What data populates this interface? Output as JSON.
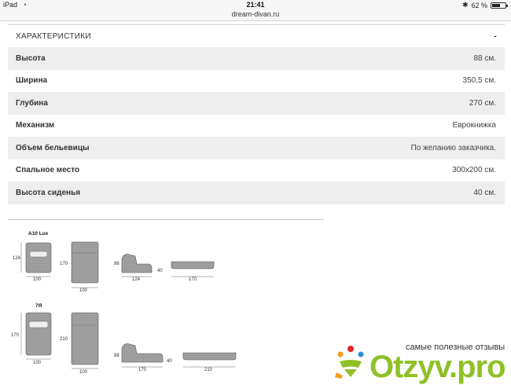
{
  "status_bar": {
    "device": "iPad",
    "time": "21:41",
    "url": "dream-divan.ru",
    "bluetooth": "✱",
    "battery_text": "62 %",
    "battery_level": 0.62
  },
  "characteristics": {
    "title": "ХАРАКТЕРИСТИКИ",
    "toggle": "-",
    "rows": [
      {
        "label": "Высота",
        "value": "88 см."
      },
      {
        "label": "Ширина",
        "value": "350,5 см."
      },
      {
        "label": "Глубина",
        "value": "270 см."
      },
      {
        "label": "Механизм",
        "value": "Еврокнижка"
      },
      {
        "label": "Объем бельевицы",
        "value": "По желанию заказчика."
      },
      {
        "label": "Спальное место",
        "value": "300х200 см."
      },
      {
        "label": "Высота сиденья",
        "value": "40 см."
      }
    ]
  },
  "diagrams": {
    "model_1": {
      "name": "A10 Lux",
      "dims": {
        "front_h": "124",
        "front_w": "100",
        "bed_h": "170",
        "bed_w": "100",
        "side_h": "88",
        "side_w": "124",
        "seat_h": "40",
        "flat_w": "170"
      }
    },
    "model_2": {
      "name": "7Я",
      "dims": {
        "front_h": "170",
        "front_w": "100",
        "bed_h": "210",
        "bed_w": "100",
        "side_h": "88",
        "side_w": "170",
        "seat_h": "40",
        "flat_w": "210"
      }
    }
  },
  "watermark": {
    "tagline": "самые полезные отзывы",
    "logo": "Otzyv.pro",
    "colors": {
      "green": "#8ec127",
      "red": "#d9262b",
      "orange": "#f39b1c",
      "blue": "#2c8fd6"
    }
  }
}
